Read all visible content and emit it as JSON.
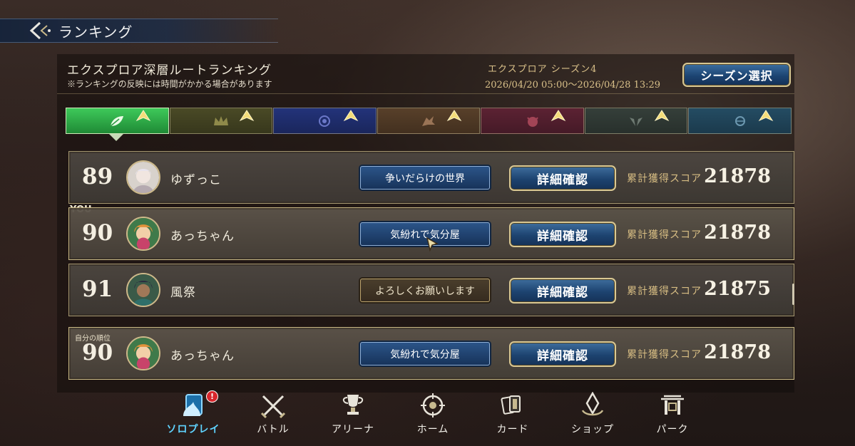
{
  "header": {
    "title": "ランキング"
  },
  "ranking": {
    "title": "エクスプロア深層ルートランキング",
    "note": "※ランキングの反映には時間がかかる場合があります",
    "season_name": "エクスプロア シーズン4",
    "season_period": "2026/04/20 05:00〜2026/04/28 13:29",
    "season_button": "シーズン選択"
  },
  "tabs": [
    {
      "emblem": "leaf-icon",
      "color": "#2fa84a",
      "active": true
    },
    {
      "emblem": "crown-icon",
      "color": "#5c5b2c",
      "active": false
    },
    {
      "emblem": "star-flower-icon",
      "color": "#2c3a8c",
      "active": false
    },
    {
      "emblem": "dragon-icon",
      "color": "#6a4a30",
      "active": false
    },
    {
      "emblem": "demon-icon",
      "color": "#6e2a3a",
      "active": false
    },
    {
      "emblem": "wings-icon",
      "color": "#3c4a44",
      "active": false
    },
    {
      "emblem": "orb-icon",
      "color": "#2c5a72",
      "active": false
    }
  ],
  "rows": [
    {
      "rank": "89",
      "name": "ゆずっこ",
      "badge": "争いだらけの世界",
      "badge_style": "blue",
      "detail": "詳細確認",
      "score_label": "累計獲得スコア",
      "score": "21878"
    },
    {
      "rank": "90",
      "name": "あっちゃん",
      "badge": "気紛れで気分屋",
      "badge_style": "blue",
      "detail": "詳細確認",
      "score_label": "累計獲得スコア",
      "score": "21878"
    },
    {
      "rank": "91",
      "name": "風祭",
      "badge": "よろしくお願いします",
      "badge_style": "gold",
      "detail": "詳細確認",
      "score_label": "累計獲得スコア",
      "score": "21875"
    }
  ],
  "you_tag": "YOU",
  "self_row": {
    "label": "自分の順位",
    "rank": "90",
    "name": "あっちゃん",
    "badge": "気紛れで気分屋",
    "detail": "詳細確認",
    "score_label": "累計獲得スコア",
    "score": "21878"
  },
  "nav": [
    {
      "label": "ソロプレイ",
      "icon": "solo-play-icon",
      "active": true,
      "alert": "!"
    },
    {
      "label": "バトル",
      "icon": "crossed-swords-icon",
      "active": false
    },
    {
      "label": "アリーナ",
      "icon": "trophy-icon",
      "active": false
    },
    {
      "label": "ホーム",
      "icon": "home-compass-icon",
      "active": false
    },
    {
      "label": "カード",
      "icon": "cards-icon",
      "active": false
    },
    {
      "label": "ショップ",
      "icon": "shop-crystal-icon",
      "active": false
    },
    {
      "label": "パーク",
      "icon": "park-gate-icon",
      "active": false
    }
  ],
  "colors": {
    "accent_blue": "#1d4370",
    "gold": "#d7bd83",
    "active_nav": "#5fd3ff",
    "alert": "#d8262c"
  }
}
